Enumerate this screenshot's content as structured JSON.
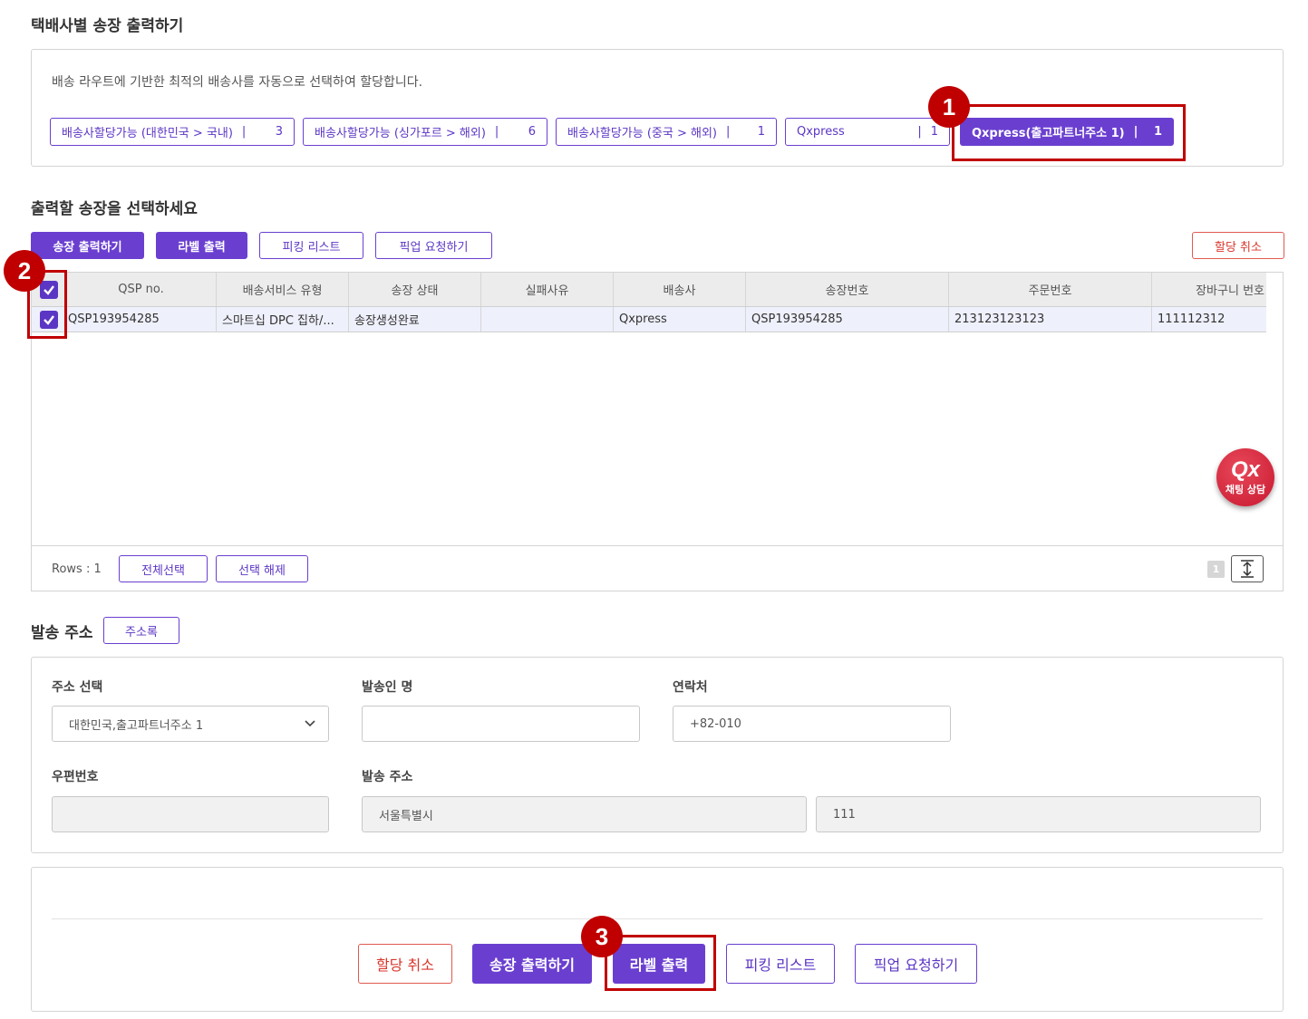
{
  "carrier_section": {
    "title": "택배사별 송장 출력하기",
    "description": "배송 라우트에 기반한 최적의 배송사를 자동으로 선택하여 할당합니다.",
    "chips": [
      {
        "label": "배송사할당가능 (대한민국 > 국내)",
        "count": "3"
      },
      {
        "label": "배송사할당가능 (싱가포르 > 해외)",
        "count": "6"
      },
      {
        "label": "배송사할당가능 (중국 > 해외)",
        "count": "1"
      },
      {
        "label": "Qxpress",
        "count": "1"
      },
      {
        "label": "Qxpress(출고파트너주소 1)",
        "count": "1"
      }
    ],
    "separator": "|"
  },
  "invoice_section": {
    "title": "출력할 송장을 선택하세요",
    "toolbar": {
      "print_invoice": "송장 출력하기",
      "print_label": "라벨 출력",
      "picking_list": "피킹 리스트",
      "pickup_request": "픽업 요청하기",
      "cancel_assign": "할당 취소"
    },
    "columns": [
      "QSP no.",
      "배송서비스 유형",
      "송장 상태",
      "실패사유",
      "배송사",
      "송장번호",
      "주문번호",
      "장바구니 번호"
    ],
    "rows": [
      [
        "QSP193954285",
        "스마트십 DPC 집하/...",
        "송장생성완료",
        "",
        "Qxpress",
        "QSP193954285",
        "213123123123",
        "111112312"
      ]
    ],
    "footer": {
      "rows_label": "Rows : 1",
      "select_all": "전체선택",
      "deselect": "선택 해제",
      "page": "1"
    }
  },
  "chat": {
    "logo": "Qx",
    "label": "채팅 상담"
  },
  "address_section": {
    "title": "발송 주소",
    "address_book": "주소록",
    "fields": {
      "address_select_label": "주소 선택",
      "address_select_value": "대한민국,출고파트너주소 1",
      "sender_label": "발송인 명",
      "sender_value": "",
      "contact_label": "연락처",
      "contact_value": "+82-010",
      "zip_label": "우편번호",
      "zip_value": "",
      "address_label": "발송 주소",
      "address1_value": "서울특별시",
      "address2_value": "111"
    }
  },
  "bottom_actions": {
    "cancel_assign": "할당 취소",
    "print_invoice": "송장 출력하기",
    "print_label": "라벨 출력",
    "picking_list": "피킹 리스트",
    "pickup_request": "픽업 요청하기"
  },
  "annotations": [
    "1",
    "2",
    "3"
  ],
  "colors": {
    "accent": "#6a3fd0",
    "danger": "#d9362b",
    "highlight": "#c00000"
  }
}
